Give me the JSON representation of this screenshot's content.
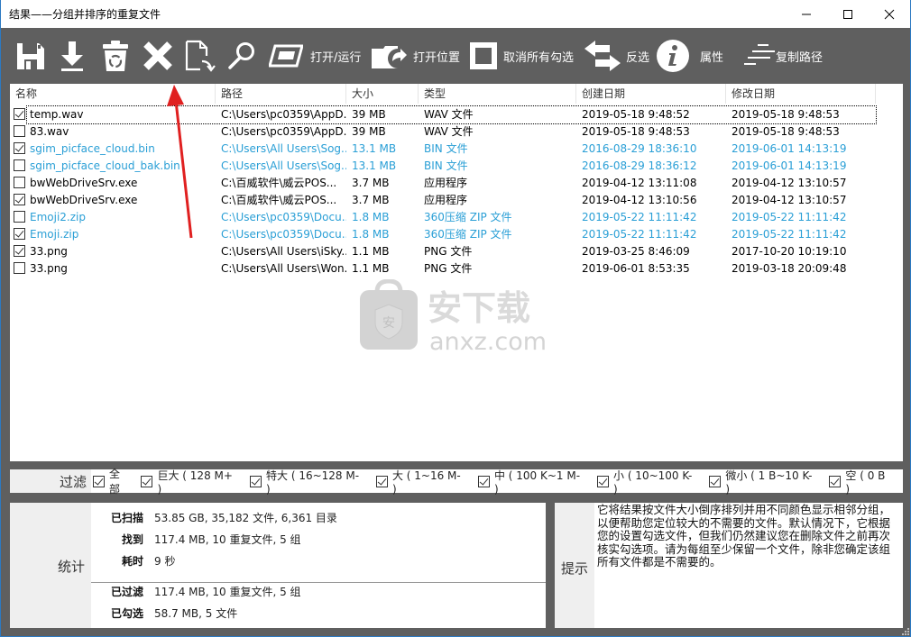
{
  "window": {
    "title": "结果——分组并排序的重复文件",
    "controls": [
      "minimize",
      "maximize",
      "close"
    ]
  },
  "toolbar": {
    "items": [
      {
        "icon": "save-icon",
        "label": ""
      },
      {
        "icon": "download-icon",
        "label": ""
      },
      {
        "icon": "recycle-bin-icon",
        "label": ""
      },
      {
        "icon": "delete-x-icon",
        "label": ""
      },
      {
        "icon": "move-file-icon",
        "label": ""
      },
      {
        "icon": "search-icon",
        "label": ""
      },
      {
        "icon": "open-run-icon",
        "label": "打开/运行"
      },
      {
        "icon": "open-folder-icon",
        "label": "打开位置"
      },
      {
        "icon": "uncheck-all-icon",
        "label": "取消所有勾选"
      },
      {
        "icon": "invert-selection-icon",
        "label": "反选"
      },
      {
        "icon": "info-icon",
        "label": "属性"
      },
      {
        "icon": "copy-path-icon",
        "label": "复制路径"
      }
    ]
  },
  "list": {
    "columns": [
      "名称",
      "路径",
      "大小",
      "类型",
      "创建日期",
      "修改日期"
    ],
    "rows": [
      {
        "checked": true,
        "name": "temp.wav",
        "path": "C:\\Users\\pc0359\\AppD...",
        "size": "39 MB",
        "type": "WAV 文件",
        "created": "2019-05-18 9:48:52",
        "modified": "2019-05-18 9:48:53",
        "color": "black",
        "focused": true
      },
      {
        "checked": false,
        "name": "83.wav",
        "path": "C:\\Users\\pc0359\\AppD...",
        "size": "39 MB",
        "type": "WAV 文件",
        "created": "2019-05-18 9:48:53",
        "modified": "2019-05-18 9:48:53",
        "color": "black",
        "focused": false
      },
      {
        "checked": true,
        "name": "sgim_picface_cloud.bin",
        "path": "C:\\Users\\All Users\\Sog...",
        "size": "13.1 MB",
        "type": "BIN 文件",
        "created": "2016-08-29 18:36:10",
        "modified": "2019-06-01 14:13:19",
        "color": "blue",
        "focused": false
      },
      {
        "checked": false,
        "name": "sgim_picface_cloud_bak.bin",
        "path": "C:\\Users\\All Users\\Sog...",
        "size": "13.1 MB",
        "type": "BIN 文件",
        "created": "2016-08-29 18:36:12",
        "modified": "2019-06-01 14:13:19",
        "color": "blue",
        "focused": false
      },
      {
        "checked": false,
        "name": "bwWebDriveSrv.exe",
        "path": "C:\\百威软件\\威云POS...",
        "size": "3.7 MB",
        "type": "应用程序",
        "created": "2019-04-12 13:11:08",
        "modified": "2019-04-12 13:10:57",
        "color": "black",
        "focused": false
      },
      {
        "checked": true,
        "name": "bwWebDriveSrv.exe",
        "path": "C:\\百威软件\\威云POS...",
        "size": "3.7 MB",
        "type": "应用程序",
        "created": "2019-04-12 13:10:56",
        "modified": "2019-04-12 13:10:57",
        "color": "black",
        "focused": false
      },
      {
        "checked": false,
        "name": "Emoji2.zip",
        "path": "C:\\Users\\pc0359\\Docu...",
        "size": "1.8 MB",
        "type": "360压缩 ZIP 文件",
        "created": "2019-05-22 11:11:42",
        "modified": "2019-05-22 11:11:42",
        "color": "blue",
        "focused": false
      },
      {
        "checked": true,
        "name": "Emoji.zip",
        "path": "C:\\Users\\pc0359\\Docu...",
        "size": "1.8 MB",
        "type": "360压缩 ZIP 文件",
        "created": "2019-05-22 11:11:42",
        "modified": "2019-05-22 11:11:42",
        "color": "blue",
        "focused": false
      },
      {
        "checked": true,
        "name": "33.png",
        "path": "C:\\Users\\All Users\\iSky...",
        "size": "1.1 MB",
        "type": "PNG 文件",
        "created": "2019-03-25 8:46:09",
        "modified": "2017-10-20 10:19:10",
        "color": "black",
        "focused": false
      },
      {
        "checked": false,
        "name": "33.png",
        "path": "C:\\Users\\All Users\\Won...",
        "size": "1.1 MB",
        "type": "PNG 文件",
        "created": "2019-06-01 8:53:35",
        "modified": "2019-03-18 20:09:48",
        "color": "black",
        "focused": false
      }
    ]
  },
  "filter": {
    "label": "过滤",
    "options": [
      {
        "label": "全部",
        "checked": true
      },
      {
        "label": "巨大 ( 128 M+ )",
        "checked": true
      },
      {
        "label": "特大 ( 16~128 M- )",
        "checked": true
      },
      {
        "label": "大 ( 1~16 M- )",
        "checked": true
      },
      {
        "label": "中 ( 100 K~1 M- )",
        "checked": true
      },
      {
        "label": "小 ( 10~100 K- )",
        "checked": true
      },
      {
        "label": "微小 ( 1 B~10 K- )",
        "checked": true
      },
      {
        "label": "空 ( 0 B )",
        "checked": true
      }
    ]
  },
  "stats": {
    "label": "统计",
    "rows": [
      {
        "key": "已扫描",
        "value": "53.85 GB, 35,182 文件, 6,361 目录"
      },
      {
        "key": "找到",
        "value": "117.4 MB, 10 重复文件, 5 组"
      },
      {
        "key": "耗时",
        "value": "9 秒"
      },
      {
        "key": "已过滤",
        "value": "117.4 MB, 10 重复文件, 5 组"
      },
      {
        "key": "已勾选",
        "value": "58.7 MB, 5 文件"
      }
    ]
  },
  "tips": {
    "label": "提示",
    "text": "它将结果按文件大小倒序排列并用不同颜色显示相邻分组，以便帮助您定位较大的不需要的文件。默认情况下，它根据您的设置勾选文件，但我们仍然建议您在删除文件之前再次核实勾选项。请为每组至少保留一个文件，除非您确定该组所有文件都是不需要的。"
  },
  "watermark": {
    "cn": "安下载",
    "en": "anxz.com",
    "badge": "安"
  },
  "colors": {
    "toolbar_bg": "#5f5f5f",
    "group_blue": "#2a9fd6",
    "panel_label_bg": "#efefef",
    "annotation_arrow": "#e02020"
  }
}
